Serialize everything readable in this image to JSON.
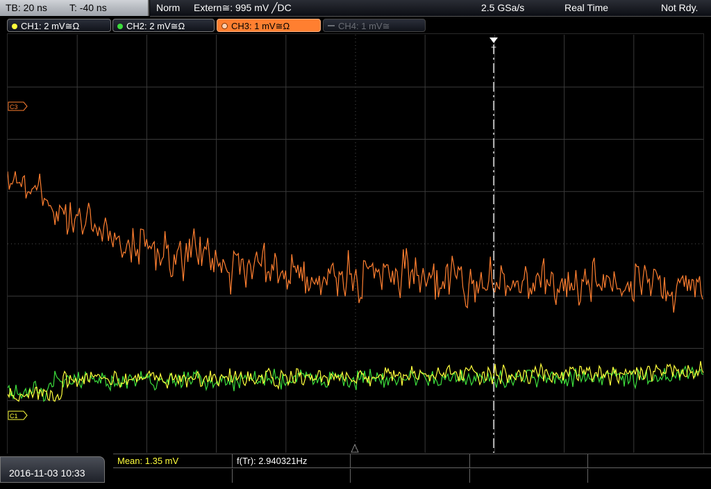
{
  "timebase": {
    "tb": "TB: 20 ns",
    "t": "T: -40 ns"
  },
  "status": {
    "mode": "Norm",
    "trigger": "Extern≅: 995 mV ╱DC",
    "sample_rate": "2.5 GSa/s",
    "acq": "Real Time",
    "state": "Not Rdy."
  },
  "channels": [
    {
      "label": "CH1: 2 mV≅Ω",
      "color": "#ffff3c",
      "state": "on"
    },
    {
      "label": "CH2: 2 mV≅Ω",
      "color": "#3cdc3c",
      "state": "on"
    },
    {
      "label": "CH3: 1 mV≅Ω",
      "color": "#ff7f30",
      "state": "active"
    },
    {
      "label": "CH4: 1 mV≅",
      "color": "#6a6d74",
      "state": "off"
    }
  ],
  "markers": {
    "ch3": "C3",
    "ch1": "C1",
    "trigger": "T"
  },
  "bottom": {
    "datetime": "2016-11-03 10:33",
    "mean": "Mean: 1.35 mV",
    "freq": "f(Tr): 2.940321Hz"
  },
  "colors": {
    "ch1": "#ffff3c",
    "ch2": "#3cdc3c",
    "ch3": "#ff7f30",
    "grid": "#3a3a3a"
  }
}
